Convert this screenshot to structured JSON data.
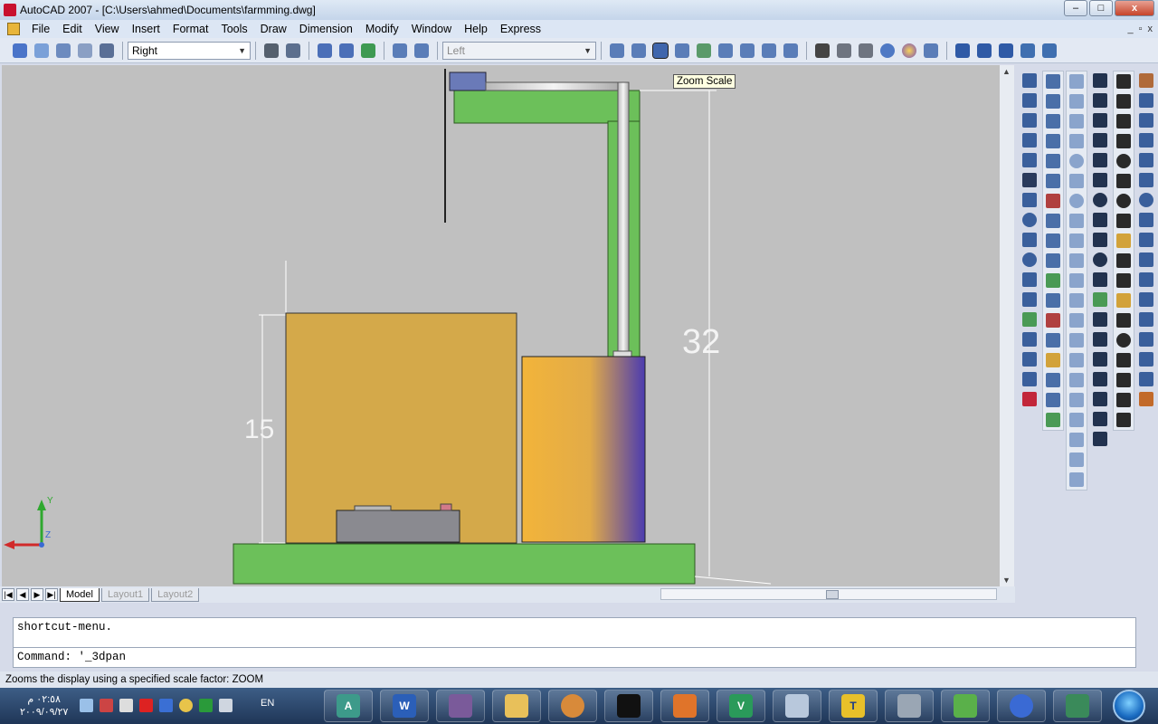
{
  "window": {
    "title": "AutoCAD 2007 - [C:\\Users\\ahmed\\Documents\\farmming.dwg]",
    "controls": {
      "minimize": "–",
      "maximize": "□",
      "close": "x"
    },
    "doc_controls": {
      "minimize": "_",
      "restore": "▫",
      "close": "x"
    }
  },
  "menu": [
    "File",
    "Edit",
    "View",
    "Insert",
    "Format",
    "Tools",
    "Draw",
    "Dimension",
    "Modify",
    "Window",
    "Help",
    "Express"
  ],
  "toolbar": {
    "view_combo": "Right",
    "visual_combo": "Left",
    "tooltip": "Zoom Scale"
  },
  "drawing": {
    "dim_height_left": "15",
    "dim_height_right": "32",
    "colors": {
      "canvas": "#c0c0c0",
      "green": "#6cc05a",
      "tan": "#d4a94a",
      "cylinder_a": "#f2b43a",
      "cylinder_b": "#4b3bb0",
      "pipe": "#cfcfcf",
      "device": "#8a8a90"
    }
  },
  "layout_tabs": [
    "Model",
    "Layout1",
    "Layout2"
  ],
  "command": {
    "history": "shortcut-menu.",
    "prompt": "Command: '_3dpan"
  },
  "status": "Zooms the display using a specified scale factor:  ZOOM",
  "taskbar": {
    "clock_time": "٠٢:٥٨ م",
    "clock_date": "٢٠٠٩/٠٩/٢٧",
    "language": "EN",
    "apps": [
      "autocad-icon",
      "word-icon",
      "video-icon",
      "folder-icon",
      "paint-icon",
      "cmd-icon",
      "pdf-icon",
      "v5-icon",
      "calculator-icon",
      "t-icon",
      "printer-icon",
      "chart-icon",
      "atom-icon",
      "monitor-icon"
    ]
  }
}
